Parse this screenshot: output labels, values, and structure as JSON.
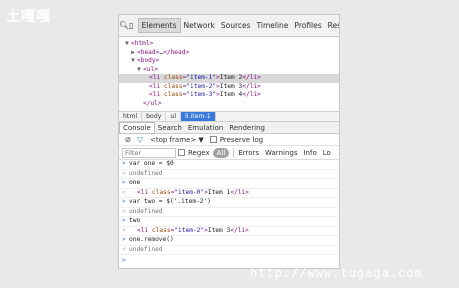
{
  "brand_text": "土嘎嘎",
  "watermark_text": "http://www.tugaga.com",
  "devtools": {
    "panel_tabs": [
      "Elements",
      "Network",
      "Sources",
      "Timeline",
      "Profiles",
      "Reso"
    ],
    "tree": {
      "html": "html",
      "head": "head",
      "head_ellipsis": "…",
      "body": "body",
      "ul": "ul",
      "li": "li",
      "attr_name": "class",
      "items": [
        {
          "class": "item-1",
          "text": "Item 2"
        },
        {
          "class": "item-2",
          "text": "Item 3"
        },
        {
          "class": "item-3",
          "text": "Item 4"
        }
      ]
    },
    "breadcrumbs": [
      "html",
      "body",
      "ul",
      "li.item-1"
    ],
    "drawer_tabs": [
      "Console",
      "Search",
      "Emulation",
      "Rendering"
    ],
    "frame_selector": "<top frame>",
    "frame_arrow": "▼",
    "preserve_log_label": "Preserve log",
    "filter_placeholder": "Filter",
    "regex_label": "Regex",
    "levels": [
      "All",
      "Errors",
      "Warnings",
      "Info",
      "Lo"
    ],
    "console": {
      "cmd1": "var one = $0",
      "undefined": "undefined",
      "ret_one": "one",
      "li_tag": "li",
      "li_attr": "class",
      "one_class": "item-0",
      "one_text": "Item 1",
      "cmd2": "var two = $('.item-2')",
      "ret_two": "two",
      "two_class": "item-2",
      "two_text": "Item 3",
      "cmd3": "one.remove()"
    }
  }
}
